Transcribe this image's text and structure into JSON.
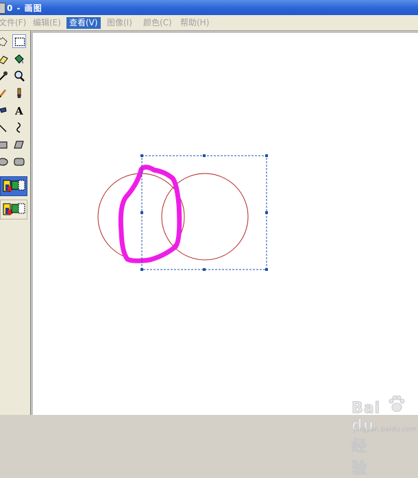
{
  "window": {
    "title": "0 - 画图"
  },
  "menu": [
    {
      "label": "文件(F)",
      "active": false
    },
    {
      "label": "编辑(E)",
      "active": false
    },
    {
      "label": "查看(V)",
      "active": true
    },
    {
      "label": "图像(I)",
      "active": false
    },
    {
      "label": "颜色(C)",
      "active": false
    },
    {
      "label": "帮助(H)",
      "active": false
    }
  ],
  "tools": [
    "free-form-select-icon",
    "rect-select-icon",
    "eraser-icon",
    "fill-icon",
    "color-picker-icon",
    "magnifier-icon",
    "pencil-icon",
    "brush-icon",
    "airbrush-icon",
    "text-icon",
    "line-icon",
    "curve-icon",
    "rectangle-icon",
    "polygon-icon",
    "ellipse-icon",
    "rounded-rect-icon"
  ],
  "selected_tool": "rect-select-icon",
  "colors": {
    "circle_stroke": "#b22222",
    "highlight_stroke": "#ee1ee8",
    "selection_dash": "#1f4fa8",
    "accent": "#316ac5"
  },
  "watermark": {
    "brand": "Bai du 经验",
    "url": "jingyan.baidu.com"
  }
}
